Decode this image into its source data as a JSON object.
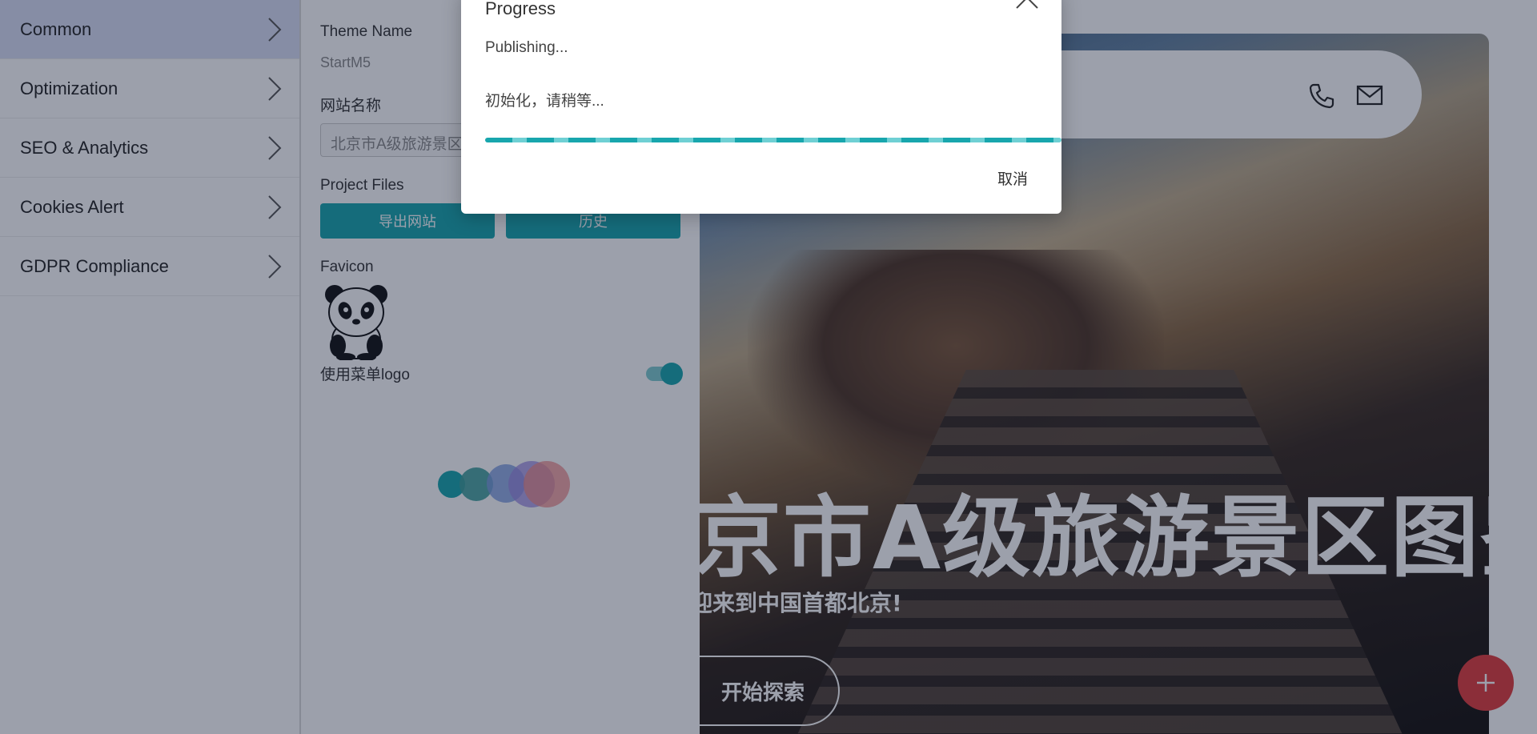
{
  "menu": {
    "items": [
      {
        "label": "Common",
        "active": true
      },
      {
        "label": "Optimization",
        "active": false
      },
      {
        "label": "SEO & Analytics",
        "active": false
      },
      {
        "label": "Cookies Alert",
        "active": false
      },
      {
        "label": "GDPR Compliance",
        "active": false
      }
    ]
  },
  "panel": {
    "theme_name_label": "Theme Name",
    "theme_name_value": "StartM5",
    "site_name_label": "网站名称",
    "site_name_value": "北京市A级旅游景区图鉴",
    "project_files_label": "Project Files",
    "export_button": "导出网站",
    "history_button": "历史",
    "favicon_label": "Favicon",
    "favicon_icon": "panda-icon",
    "menu_logo_label": "使用菜单logo",
    "menu_logo_enabled": true,
    "loading_dots": [
      "#18a6ad",
      "#4fa3a0",
      "#6b8fd0",
      "#8c7fd4",
      "#e06b6b"
    ]
  },
  "preview": {
    "hero_title": "北京市A级旅游景区图鉴",
    "hero_subtitle": "欢迎来到中国首都北京!",
    "hero_button": "开始探索",
    "header_icons": [
      "phone-icon",
      "mail-icon"
    ],
    "fab_icon": "plus-icon"
  },
  "dialog": {
    "title": "Progress",
    "status": "Publishing...",
    "message": "初始化，请稍等...",
    "cancel": "取消"
  },
  "colors": {
    "accent": "#18a6ad",
    "fab": "#e23c3c",
    "overlay": "rgba(20,28,56,0.42)"
  }
}
